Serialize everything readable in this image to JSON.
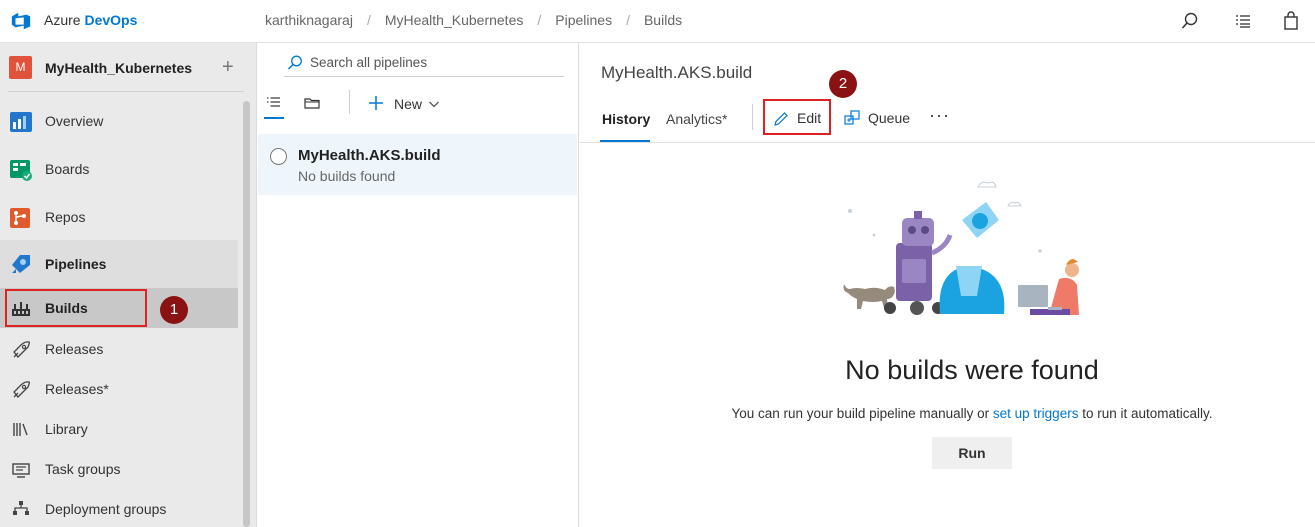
{
  "app": {
    "brand_prefix": "Azure",
    "brand_suffix": "DevOps"
  },
  "breadcrumb": [
    "karthiknagaraj",
    "MyHealth_Kubernetes",
    "Pipelines",
    "Builds"
  ],
  "top_icons": [
    "search-icon",
    "list-icon",
    "shopping-bag-icon"
  ],
  "project": {
    "avatar_letter": "M",
    "name": "MyHealth_Kubernetes",
    "add_symbol": "+"
  },
  "sidebar": {
    "items": [
      {
        "label": "Overview",
        "icon": "overview-icon"
      },
      {
        "label": "Boards",
        "icon": "boards-icon"
      },
      {
        "label": "Repos",
        "icon": "repos-icon"
      },
      {
        "label": "Pipelines",
        "icon": "pipelines-icon"
      },
      {
        "label": "Builds",
        "icon": "builds-icon"
      },
      {
        "label": "Releases",
        "icon": "rocket-icon"
      },
      {
        "label": "Releases*",
        "icon": "rocket-icon"
      },
      {
        "label": "Library",
        "icon": "library-icon"
      },
      {
        "label": "Task groups",
        "icon": "task-groups-icon"
      },
      {
        "label": "Deployment groups",
        "icon": "deployment-groups-icon"
      }
    ]
  },
  "callouts": {
    "one": "1",
    "two": "2"
  },
  "pipelines_list": {
    "search_placeholder": "Search all pipelines",
    "new_label": "New",
    "items": [
      {
        "name": "MyHealth.AKS.build",
        "status": "No builds found"
      }
    ]
  },
  "detail": {
    "title": "MyHealth.AKS.build",
    "tabs": [
      "History",
      "Analytics*"
    ],
    "edit_label": "Edit",
    "queue_label": "Queue",
    "more_label": "···",
    "empty": {
      "title": "No builds were found",
      "desc_before": "You can run your build pipeline manually or ",
      "desc_link": "set up triggers",
      "desc_after": " to run it automatically.",
      "run_label": "Run"
    }
  },
  "colors": {
    "accent": "#0078d4",
    "callout_red": "#d22222",
    "badge": "#8b1212",
    "project_avatar": "#e0533a"
  }
}
